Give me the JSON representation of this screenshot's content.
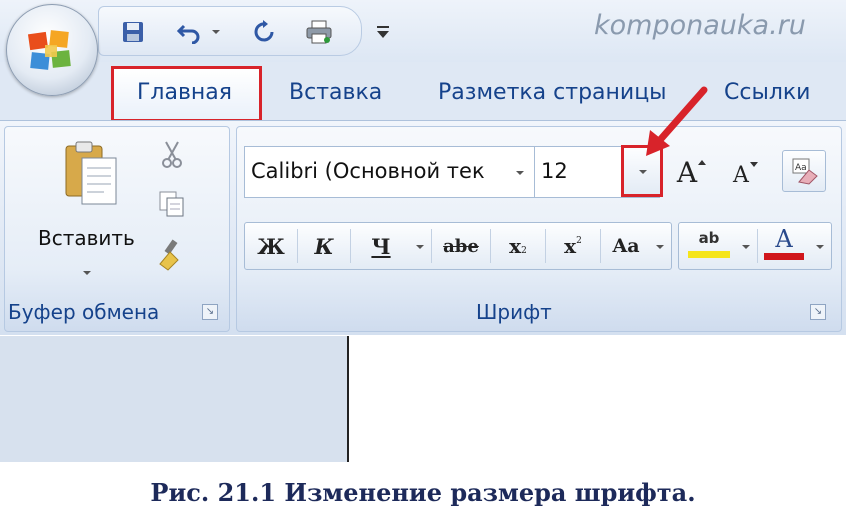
{
  "watermark": "komponauka.ru",
  "tabs": {
    "home": "Главная",
    "insert": "Вставка",
    "page_layout": "Разметка страницы",
    "references": "Ссылки"
  },
  "clipboard": {
    "paste_label": "Вставить",
    "group_label": "Буфер обмена"
  },
  "font": {
    "group_label": "Шрифт",
    "font_name": "Calibri (Основной тек",
    "font_size": "12",
    "grow_label": "A",
    "shrink_label": "A",
    "bold_label": "Ж",
    "italic_label": "К",
    "underline_label": "Ч",
    "strike_label": "abe",
    "subscript_label": "x",
    "superscript_label": "x",
    "case_label": "Aa",
    "highlight_label": "ab",
    "color_label": "A"
  },
  "caption": "Рис. 21.1 Изменение размера шрифта.",
  "colors": {
    "highlight_yellow": "#f5e51b",
    "font_red": "#d0161c",
    "annotation_red": "#d8232a"
  }
}
